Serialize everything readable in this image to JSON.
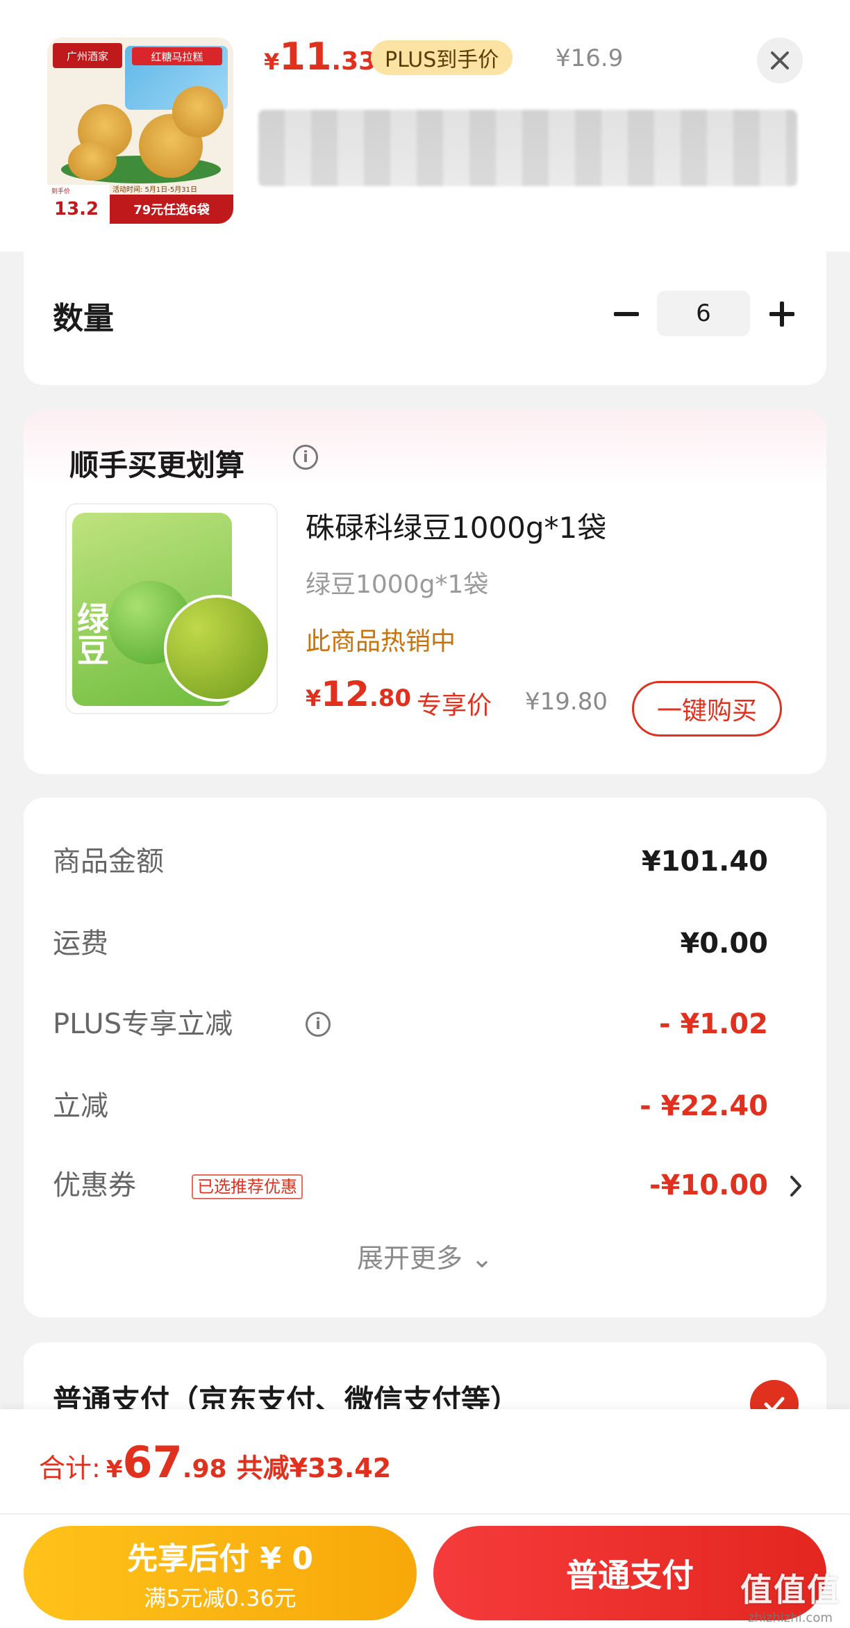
{
  "header": {
    "thumb": {
      "brand": "广州酒家",
      "bag_title": "红糖马拉糕",
      "promo_date": "活动时间: 5月1日-5月31日",
      "price_small": "到手价",
      "price": "13.2",
      "promo": "79元任选6袋"
    },
    "price_symbol": "¥",
    "price_int": "11",
    "price_dec": ".33",
    "plus_badge": "PLUS到手价",
    "original_price": "¥16.9",
    "close_icon": "close-icon"
  },
  "quantity": {
    "label": "数量",
    "minus": "−",
    "value": "6",
    "plus": "+"
  },
  "addon": {
    "title": "顺手买更划算",
    "info": "i",
    "image_text": "绿豆",
    "name": "硃碌科绿豆1000g*1袋",
    "spec": "绿豆1000g*1袋",
    "hot": "此商品热销中",
    "price_symbol": "¥",
    "price_int": "12",
    "price_dec": ".80",
    "exclusive": "专享价",
    "original_price": "¥19.80",
    "buy_button": "一键购买"
  },
  "summary": {
    "rows": [
      {
        "label": "商品金额",
        "value": "¥101.40"
      },
      {
        "label": "运费",
        "value": "¥0.00"
      },
      {
        "label": "PLUS专享立减",
        "value": "- ¥1.02"
      },
      {
        "label": "立减",
        "value": "- ¥22.40"
      },
      {
        "label": "优惠券",
        "tag": "已选推荐优惠",
        "value": "-¥10.00"
      }
    ],
    "info": "i",
    "expand": "展开更多 ⌄"
  },
  "payment": {
    "title": "普通支付（京东支付、微信支付等）"
  },
  "bottom": {
    "total_label": "合计:",
    "total_symbol": "¥",
    "total_int": "67",
    "total_dec": ".98",
    "saved": "共减¥33.42",
    "later_line1": "先享后付 ¥ 0",
    "later_line2": "满5元减0.36元",
    "normal_pay": "普通支付"
  },
  "watermark": {
    "line1": "值值值",
    "line2": "zhizhizhi.com"
  },
  "colors": {
    "accent": "#e0301e",
    "plus_badge_bg": "#fbe3a3",
    "later_button": "#ffc21a",
    "hot_text": "#c8720b"
  }
}
